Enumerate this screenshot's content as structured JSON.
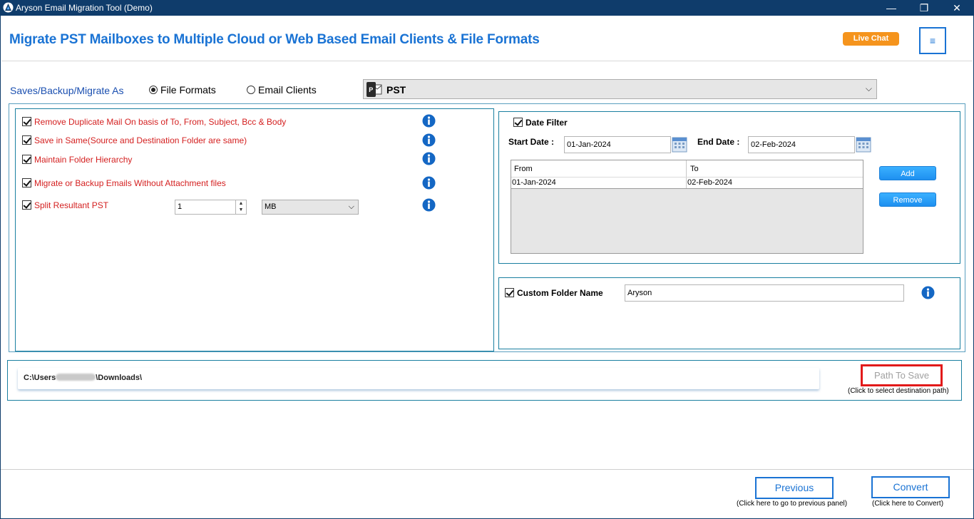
{
  "window": {
    "title": "Aryson Email Migration Tool (Demo)",
    "controls": {
      "minimize": "—",
      "restore": "❐",
      "close": "✕"
    }
  },
  "header": {
    "title": "Migrate PST Mailboxes to Multiple Cloud or Web Based Email Clients & File Formats",
    "live_chat": "Live Chat",
    "menu_glyph": "≡"
  },
  "save_as": {
    "label": "Saves/Backup/Migrate As",
    "option_file_formats": "File Formats",
    "option_email_clients": "Email Clients",
    "selected_option": "File Formats",
    "format_value": "PST"
  },
  "options": {
    "items": [
      {
        "label": "Remove Duplicate Mail On basis of To, From, Subject, Bcc & Body",
        "checked": true
      },
      {
        "label": "Save in Same(Source and Destination Folder are same)",
        "checked": true
      },
      {
        "label": "Maintain Folder Hierarchy",
        "checked": true
      },
      {
        "label": "Migrate or Backup Emails Without Attachment files",
        "checked": true
      },
      {
        "label": "Split Resultant PST",
        "checked": true
      }
    ],
    "split_value": "1",
    "split_unit": "MB"
  },
  "date_filter": {
    "label": "Date Filter",
    "checked": true,
    "start_label": "Start Date :",
    "start_value": "01-Jan-2024",
    "end_label": "End Date :",
    "end_value": "02-Feb-2024",
    "table": {
      "columns": [
        "From",
        "To"
      ],
      "rows": [
        [
          "01-Jan-2024",
          "02-Feb-2024"
        ]
      ]
    },
    "add_label": "Add",
    "remove_label": "Remove"
  },
  "custom_folder": {
    "label": "Custom Folder Name",
    "checked": true,
    "value": "Aryson"
  },
  "path": {
    "prefix": "C:\\Users",
    "suffix": "\\Downloads\\",
    "button_label": "Path To Save",
    "hint": "(Click to select destination path)"
  },
  "footer": {
    "previous_label": "Previous",
    "previous_hint": "(Click here to go to previous panel)",
    "convert_label": "Convert",
    "convert_hint": "(Click here to Convert)"
  },
  "colors": {
    "title_bar": "#0f3c6b",
    "accent_blue": "#1a73d4",
    "option_red": "#d42020",
    "live_chat_orange": "#f5941d",
    "highlight_red": "#e21a1a"
  }
}
